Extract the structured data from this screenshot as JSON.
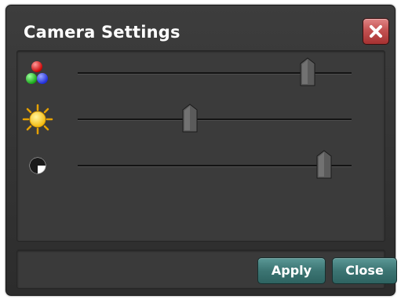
{
  "dialog": {
    "title": "Camera Settings",
    "close_icon": "close-x-icon",
    "accent_close": "#c45252",
    "button_color": "#3c7573"
  },
  "sliders": [
    {
      "name": "color",
      "icon": "rgb-dots-icon",
      "value": 0.84
    },
    {
      "name": "brightness",
      "icon": "sun-icon",
      "value": 0.41
    },
    {
      "name": "contrast",
      "icon": "contrast-icon",
      "value": 0.9
    }
  ],
  "footer": {
    "apply_label": "Apply",
    "close_label": "Close"
  }
}
